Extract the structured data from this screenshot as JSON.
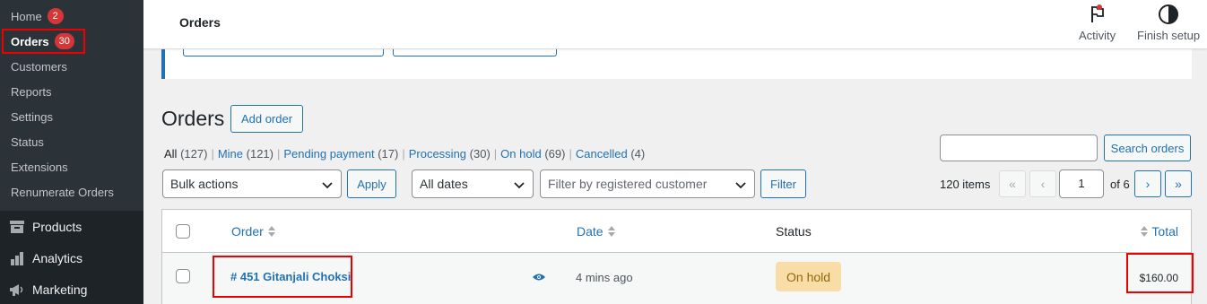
{
  "sidebar": {
    "submenu": [
      {
        "label": "Home",
        "badge": "2"
      },
      {
        "label": "Orders",
        "badge": "30"
      },
      {
        "label": "Customers"
      },
      {
        "label": "Reports"
      },
      {
        "label": "Settings"
      },
      {
        "label": "Status"
      },
      {
        "label": "Extensions"
      },
      {
        "label": "Renumerate Orders"
      }
    ],
    "main": [
      {
        "label": "Products",
        "icon": "archive-icon"
      },
      {
        "label": "Analytics",
        "icon": "bar-chart-icon"
      },
      {
        "label": "Marketing",
        "icon": "megaphone-icon"
      }
    ]
  },
  "header": {
    "title": "Orders",
    "activity_label": "Activity",
    "finish_setup_label": "Finish setup"
  },
  "page": {
    "heading": "Orders",
    "add_order_label": "Add order"
  },
  "views": [
    {
      "label": "All",
      "count": "(127)"
    },
    {
      "label": "Mine",
      "count": "(121)"
    },
    {
      "label": "Pending payment",
      "count": "(17)"
    },
    {
      "label": "Processing",
      "count": "(30)"
    },
    {
      "label": "On hold",
      "count": "(69)"
    },
    {
      "label": "Cancelled",
      "count": "(4)"
    }
  ],
  "search": {
    "button_label": "Search orders",
    "value": ""
  },
  "filters": {
    "bulk_actions": "Bulk actions",
    "apply_label": "Apply",
    "dates": "All dates",
    "customer_placeholder": "Filter by registered customer",
    "filter_label": "Filter"
  },
  "pagination": {
    "items": "120 items",
    "first": "«",
    "prev": "‹",
    "current_page": "1",
    "of_pages": "of 6",
    "next": "›",
    "last": "»"
  },
  "table": {
    "columns": {
      "order": "Order",
      "date": "Date",
      "status": "Status",
      "total": "Total"
    },
    "rows": [
      {
        "order": "# 451 Gitanjali Choksi",
        "date": "4 mins ago",
        "status": "On hold",
        "total": "$160.00"
      }
    ]
  },
  "colors": {
    "accent": "#2271b1",
    "badge": "#d63638",
    "highlight": "#ee0000",
    "on_hold_bg": "#f8dda7"
  }
}
